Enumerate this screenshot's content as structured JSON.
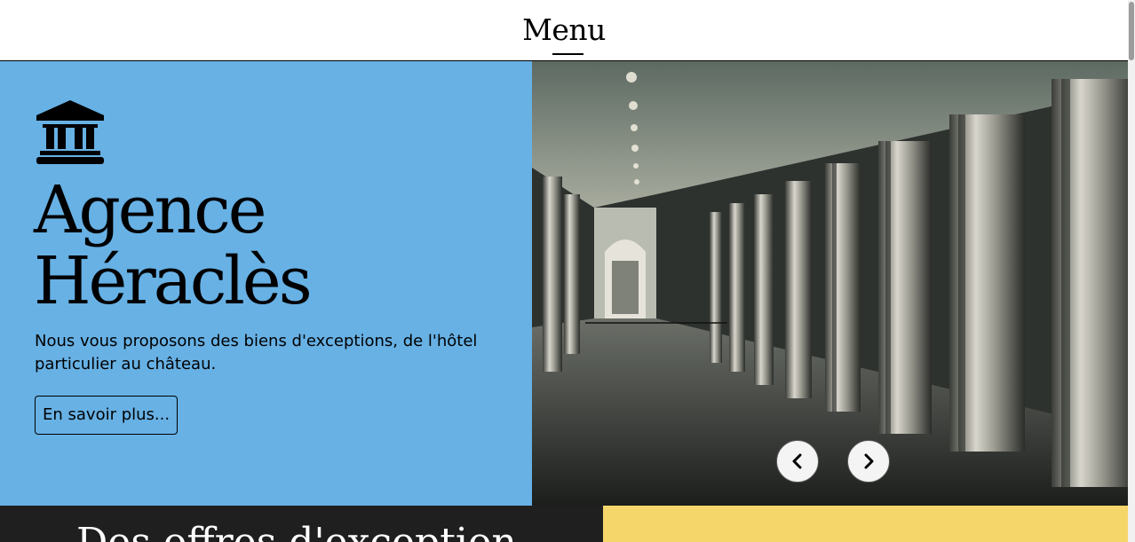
{
  "header": {
    "menu_label": "Menu"
  },
  "hero": {
    "icon": "bank-building-icon",
    "title_line1": "Agence",
    "title_line2": "Héraclès",
    "description": "Nous vous proposons des biens d'exceptions, de l'hôtel particulier au château.",
    "cta_label": "En savoir plus...",
    "background_color": "#67b1e5"
  },
  "carousel": {
    "image": "palace-corridor-with-ornate-columns",
    "prev_icon": "chevron-left-icon",
    "next_icon": "chevron-right-icon"
  },
  "offers": {
    "title": "Des offres d'exception",
    "left_color": "#1f1f1f",
    "right_color": "#f5d66a"
  }
}
